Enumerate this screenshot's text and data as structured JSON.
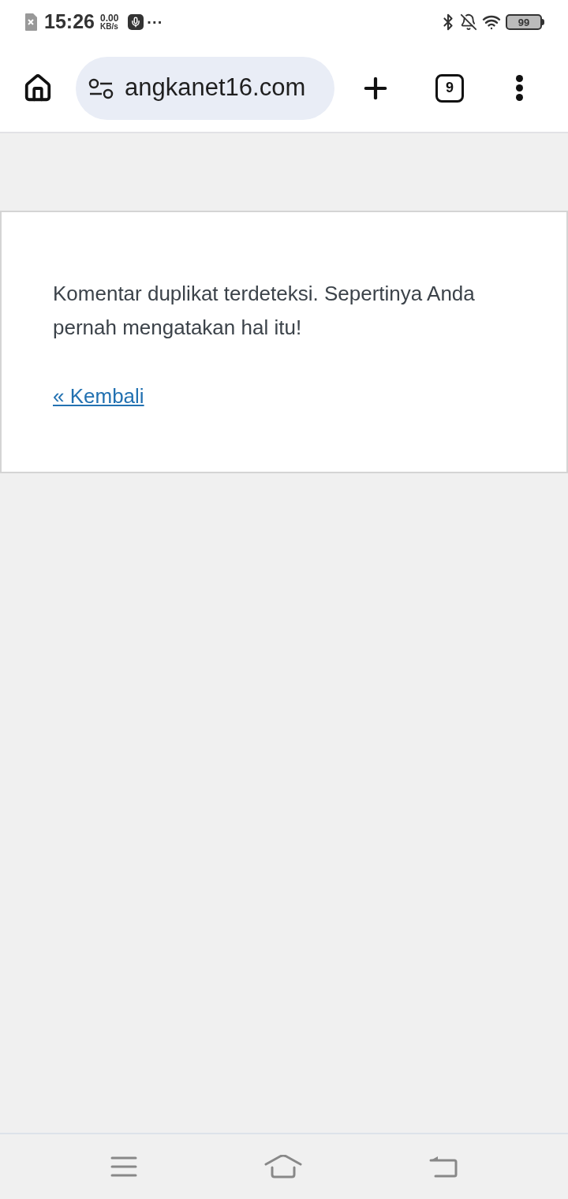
{
  "status_bar": {
    "time": "15:26",
    "net_speed": "0.00",
    "net_unit": "KB/s",
    "more": "···",
    "battery": "99"
  },
  "toolbar": {
    "url": "angkanet16.com",
    "tab_count": "9"
  },
  "page": {
    "message": "Komentar duplikat terdeteksi. Sepertinya Anda pernah mengatakan hal itu!",
    "back_link": "« Kembali"
  }
}
